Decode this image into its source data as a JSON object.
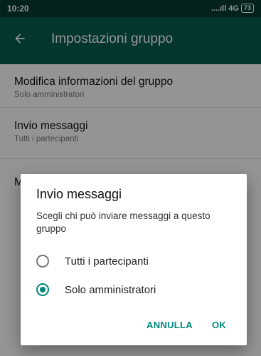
{
  "status_bar": {
    "time": "10:20",
    "signal_text": "....ıll 4G",
    "battery": "73"
  },
  "app_bar": {
    "title": "Impostazioni gruppo",
    "back_icon": "arrow-left-icon"
  },
  "settings": [
    {
      "title": "Modifica informazioni del gruppo",
      "subtitle": "Solo amministratori"
    },
    {
      "title": "Invio messaggi",
      "subtitle": "Tutti i partecipanti"
    },
    {
      "title": "M",
      "subtitle": ""
    }
  ],
  "dialog": {
    "title": "Invio messaggi",
    "message": "Scegli chi può inviare messaggi a questo gruppo",
    "options": [
      {
        "label": "Tutti i partecipanti",
        "selected": false
      },
      {
        "label": "Solo amministratori",
        "selected": true
      }
    ],
    "cancel_label": "ANNULLA",
    "ok_label": "OK"
  },
  "colors": {
    "status_bar": "#043b30",
    "app_bar": "#075e54",
    "accent": "#00897b"
  }
}
